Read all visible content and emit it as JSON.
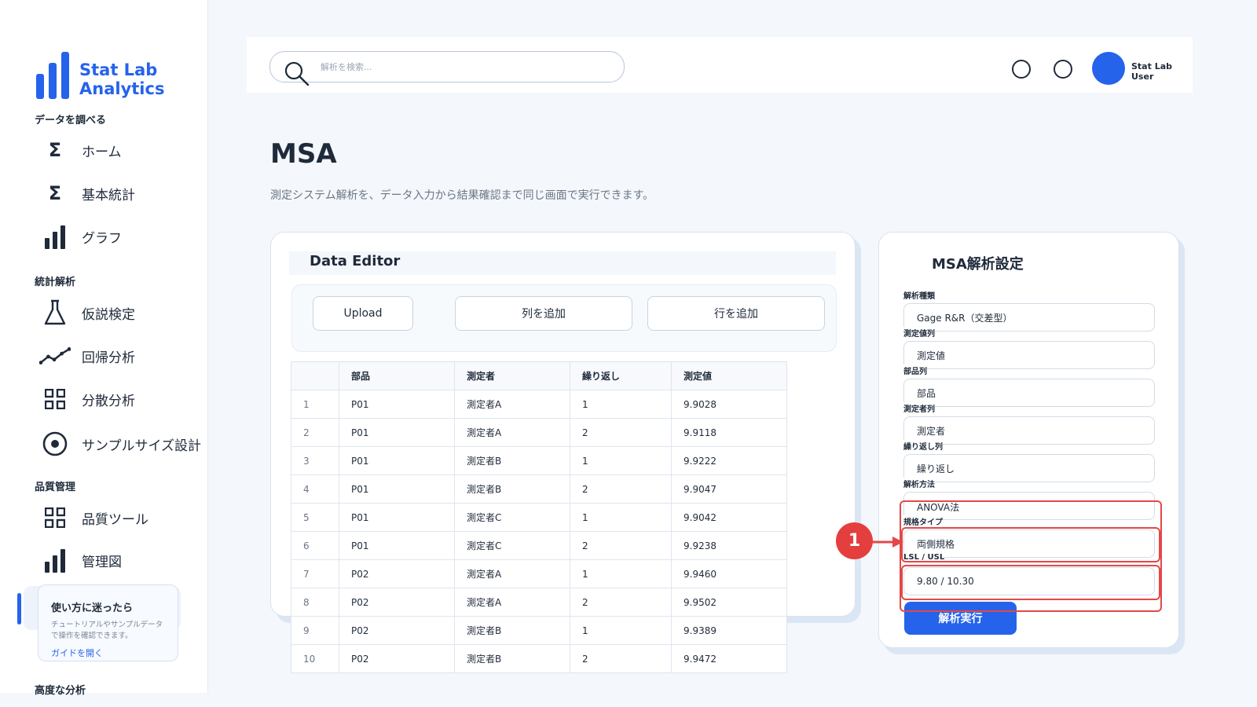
{
  "brand": {
    "name": "Stat Lab Analytics",
    "logo_icon": "bar-chart-icon",
    "color": "#2563eb"
  },
  "sidebar": {
    "sections": [
      {
        "title": "データを調べる",
        "items": [
          {
            "label": "ホーム",
            "icon": "sigma-icon"
          },
          {
            "label": "基本統計",
            "icon": "sigma-icon"
          },
          {
            "label": "グラフ",
            "icon": "bar-chart-icon"
          }
        ]
      },
      {
        "title": "統計解析",
        "items": [
          {
            "label": "仮説検定",
            "icon": "flask-icon"
          },
          {
            "label": "回帰分析",
            "icon": "trend-line-icon"
          },
          {
            "label": "分散分析",
            "icon": "grid-icon"
          },
          {
            "label": "サンプルサイズ設計",
            "icon": "target-icon"
          }
        ]
      },
      {
        "title": "品質管理",
        "items": [
          {
            "label": "品質ツール",
            "icon": "grid-icon"
          },
          {
            "label": "管理図",
            "icon": "bar-chart-icon"
          }
        ]
      },
      {
        "title": "高度な分析",
        "items": []
      }
    ],
    "help": {
      "title": "使い方に迷ったら",
      "description": "チュートリアルやサンプルデータで操作を確認できます。",
      "link": "ガイドを開く"
    }
  },
  "topbar": {
    "search_placeholder": "解析を検索...",
    "user_name": "Stat Lab User"
  },
  "page": {
    "title": "MSA",
    "subtitle": "測定システム解析を、データ入力から結果確認まで同じ画面で実行できます。"
  },
  "editor": {
    "title": "Data Editor",
    "buttons": {
      "upload": "Upload",
      "add_column": "列を追加",
      "add_row": "行を追加"
    },
    "columns": [
      "",
      "部品",
      "測定者",
      "繰り返し",
      "測定値"
    ],
    "rows": [
      [
        "1",
        "P01",
        "測定者A",
        "1",
        "9.9028"
      ],
      [
        "2",
        "P01",
        "測定者A",
        "2",
        "9.9118"
      ],
      [
        "3",
        "P01",
        "測定者B",
        "1",
        "9.9222"
      ],
      [
        "4",
        "P01",
        "測定者B",
        "2",
        "9.9047"
      ],
      [
        "5",
        "P01",
        "測定者C",
        "1",
        "9.9042"
      ],
      [
        "6",
        "P01",
        "測定者C",
        "2",
        "9.9238"
      ],
      [
        "7",
        "P02",
        "測定者A",
        "1",
        "9.9460"
      ],
      [
        "8",
        "P02",
        "測定者A",
        "2",
        "9.9502"
      ],
      [
        "9",
        "P02",
        "測定者B",
        "1",
        "9.9389"
      ],
      [
        "10",
        "P02",
        "測定者B",
        "2",
        "9.9472"
      ]
    ]
  },
  "settings": {
    "title": "MSA解析設定",
    "fields": [
      {
        "label": "解析種類",
        "value": "Gage R&R（交差型）"
      },
      {
        "label": "測定値列",
        "value": "測定値"
      },
      {
        "label": "部品列",
        "value": "部品"
      },
      {
        "label": "測定者列",
        "value": "測定者"
      },
      {
        "label": "繰り返し列",
        "value": "繰り返し"
      },
      {
        "label": "解析方法",
        "value": "ANOVA法"
      },
      {
        "label": "規格タイプ",
        "value": "両側規格"
      },
      {
        "label": "LSL / USL",
        "value": "9.80 / 10.30"
      }
    ],
    "run_button": "解析実行"
  },
  "annotation": {
    "badge": "1",
    "color": "#e34848"
  }
}
